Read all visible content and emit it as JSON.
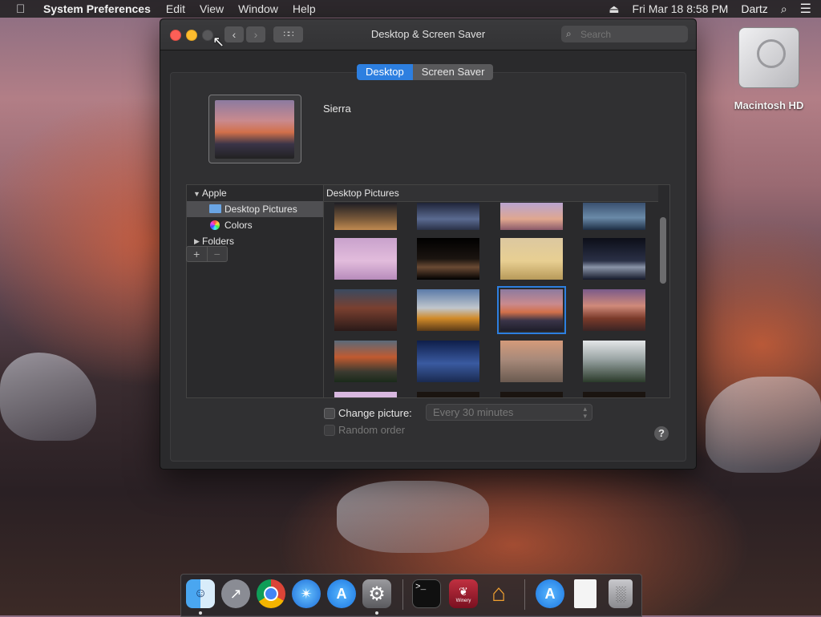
{
  "menubar": {
    "apple": "",
    "app_name": "System Preferences",
    "menus": [
      "Edit",
      "View",
      "Window",
      "Help"
    ],
    "datetime": "Fri Mar 18  8:58 PM",
    "user": "Dartz"
  },
  "window": {
    "title": "Desktop & Screen Saver",
    "search_placeholder": "Search",
    "tabs": [
      {
        "label": "Desktop",
        "selected": true
      },
      {
        "label": "Screen Saver",
        "selected": false
      }
    ],
    "preview_name": "Sierra",
    "sources": {
      "apple_label": "Apple",
      "desktop_pictures_label": "Desktop Pictures",
      "colors_label": "Colors",
      "folders_label": "Folders"
    },
    "grid_header": "Desktop Pictures",
    "thumbnails": [
      {
        "name": "sand-dune-dusk"
      },
      {
        "name": "blue-dunes"
      },
      {
        "name": "desert-rock"
      },
      {
        "name": "blue-lake"
      },
      {
        "name": "pink-lake-rock"
      },
      {
        "name": "lake-pinnacles"
      },
      {
        "name": "golden-dunes"
      },
      {
        "name": "night-dunes"
      },
      {
        "name": "red-mountains"
      },
      {
        "name": "autumn-peaks"
      },
      {
        "name": "sierra",
        "selected": true
      },
      {
        "name": "pink-peaks"
      },
      {
        "name": "el-capitan"
      },
      {
        "name": "blue-range"
      },
      {
        "name": "half-dome"
      },
      {
        "name": "forest-mist"
      }
    ],
    "add_label": "+",
    "remove_label": "−",
    "change_picture_label": "Change picture:",
    "interval_value": "Every 30 minutes",
    "random_order_label": "Random order",
    "help_label": "?"
  },
  "desktop": {
    "hd_label": "Macintosh HD"
  },
  "dock": {
    "apps": [
      "Finder",
      "Launchpad",
      "Chrome",
      "Safari",
      "App Store",
      "System Preferences",
      "Terminal",
      "Winery",
      "Home",
      "Downloads",
      "Document",
      "Trash"
    ],
    "winery_label": "Winery"
  }
}
